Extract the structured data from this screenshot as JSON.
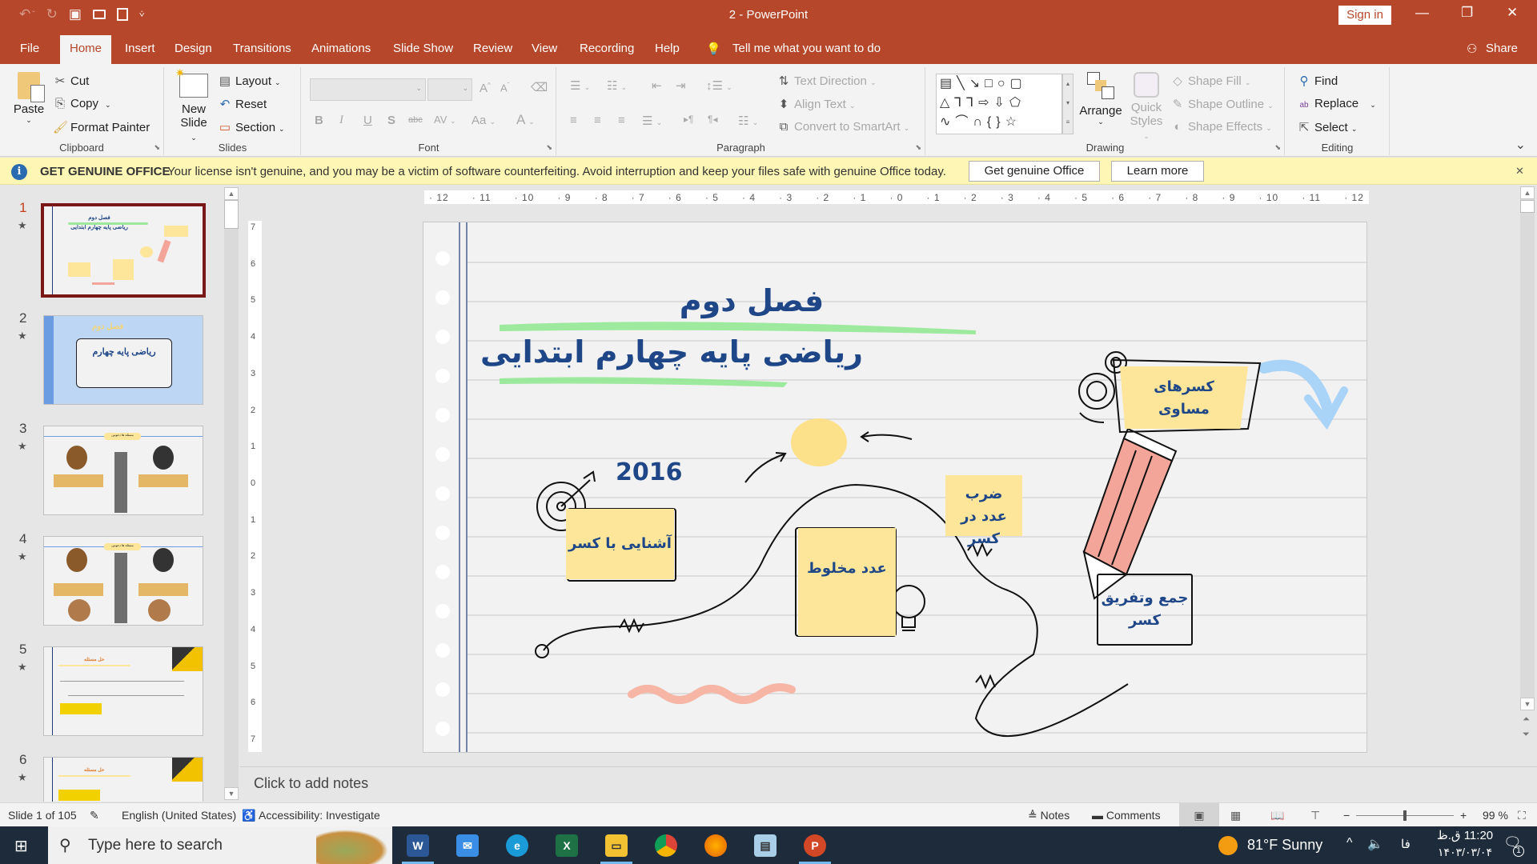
{
  "window": {
    "title": "2  -  PowerPoint",
    "sign_in": "Sign in",
    "minimize": "—",
    "restore": "❐",
    "close": "✕"
  },
  "qat": {
    "undo": "↶",
    "undo_menu": "ˇ",
    "redo": "↻",
    "present": "▣",
    "open": "📂",
    "save": "💾",
    "customize": "⩒"
  },
  "tabs": [
    "File",
    "Home",
    "Insert",
    "Design",
    "Transitions",
    "Animations",
    "Slide Show",
    "Review",
    "View",
    "Recording",
    "Help"
  ],
  "active_tab": "Home",
  "tell_me": "Tell me what you want to do",
  "share": "Share",
  "ribbon": {
    "clipboard": {
      "label": "Clipboard",
      "paste": "Paste",
      "cut": "Cut",
      "copy": "Copy",
      "format_painter": "Format Painter"
    },
    "slides": {
      "label": "Slides",
      "new_slide_1": "New",
      "new_slide_2": "Slide",
      "layout": "Layout",
      "reset": "Reset",
      "section": "Section"
    },
    "font": {
      "label": "Font",
      "font_name": "",
      "font_size": "",
      "bold": "B",
      "italic": "I",
      "underline": "U",
      "shadow": "S",
      "strike": "abc",
      "spacing": "AV",
      "case": "Aa",
      "color": "A",
      "grow": "A",
      "shrink": "A"
    },
    "paragraph": {
      "label": "Paragraph",
      "text_direction": "Text Direction",
      "align_text": "Align Text",
      "convert_smartart": "Convert to SmartArt"
    },
    "drawing": {
      "label": "Drawing",
      "arrange": "Arrange",
      "quick_styles_1": "Quick",
      "quick_styles_2": "Styles",
      "shape_fill": "Shape Fill",
      "shape_outline": "Shape Outline",
      "shape_effects": "Shape Effects"
    },
    "editing": {
      "label": "Editing",
      "find": "Find",
      "replace": "Replace",
      "select": "Select"
    }
  },
  "infobar": {
    "title": "GET GENUINE OFFICE",
    "message": "Your license isn't genuine, and you may be a victim of software counterfeiting. Avoid interruption and keep your files safe with genuine Office today.",
    "button_get": "Get genuine Office",
    "button_learn": "Learn more",
    "close": "✕"
  },
  "ruler_ticks": [
    "12",
    "11",
    "10",
    "9",
    "8",
    "7",
    "6",
    "5",
    "4",
    "3",
    "2",
    "1",
    "0",
    "1",
    "2",
    "3",
    "4",
    "5",
    "6",
    "7",
    "8",
    "9",
    "10",
    "11",
    "12"
  ],
  "vruler_ticks": [
    "7",
    "6",
    "5",
    "4",
    "3",
    "2",
    "1",
    "0",
    "1",
    "2",
    "3",
    "4",
    "5",
    "6",
    "7"
  ],
  "thumbnails": [
    {
      "num": "1",
      "star": "★",
      "title": "فصل دوم",
      "subtitle": "ریاضی پایه چهارم ابتدایی"
    },
    {
      "num": "2",
      "star": "★",
      "title": "فصل دوم",
      "subtitle": "ریاضی پایه چهارم"
    },
    {
      "num": "3",
      "star": "★",
      "label": "مسئله ها دعوتین"
    },
    {
      "num": "4",
      "star": "★",
      "label": "مسئله ها دعوتین"
    },
    {
      "num": "5",
      "star": "★",
      "label": "حل مسئله"
    },
    {
      "num": "6",
      "star": "★",
      "label": "حل مسئله"
    }
  ],
  "slide": {
    "title": "فصل دوم",
    "subtitle": "ریاضی پایه چهارم ابتدایی",
    "year": "2016",
    "notes": [
      {
        "id": "intro",
        "text": "آشنایی با کسر"
      },
      {
        "id": "mixed",
        "text": "عدد مخلوط"
      },
      {
        "id": "multiply",
        "text": "ضرب عدد در کسر"
      },
      {
        "id": "equivalent",
        "text": "کسرهای مساوی"
      },
      {
        "id": "addsub",
        "text": "جمع وتفریق کسر"
      }
    ]
  },
  "notes_placeholder": "Click to add notes",
  "status": {
    "slide": "Slide 1 of 105",
    "language": "English (United States)",
    "accessibility": "Accessibility: Investigate",
    "notes": "Notes",
    "comments": "Comments",
    "zoom": "99 %",
    "zoom_level": 0.5
  },
  "taskbar": {
    "search_placeholder": "Type here to search",
    "weather": "81°F  Sunny",
    "lang": "فا",
    "time": "11:20 ق.ظ",
    "date": "۱۴۰۳/۰۳/۰۴",
    "notif_count": "1",
    "apps": [
      "Word",
      "Mail",
      "Edge",
      "Excel",
      "File Explorer",
      "Chrome",
      "Firefox",
      "Notepad",
      "PowerPoint"
    ]
  }
}
